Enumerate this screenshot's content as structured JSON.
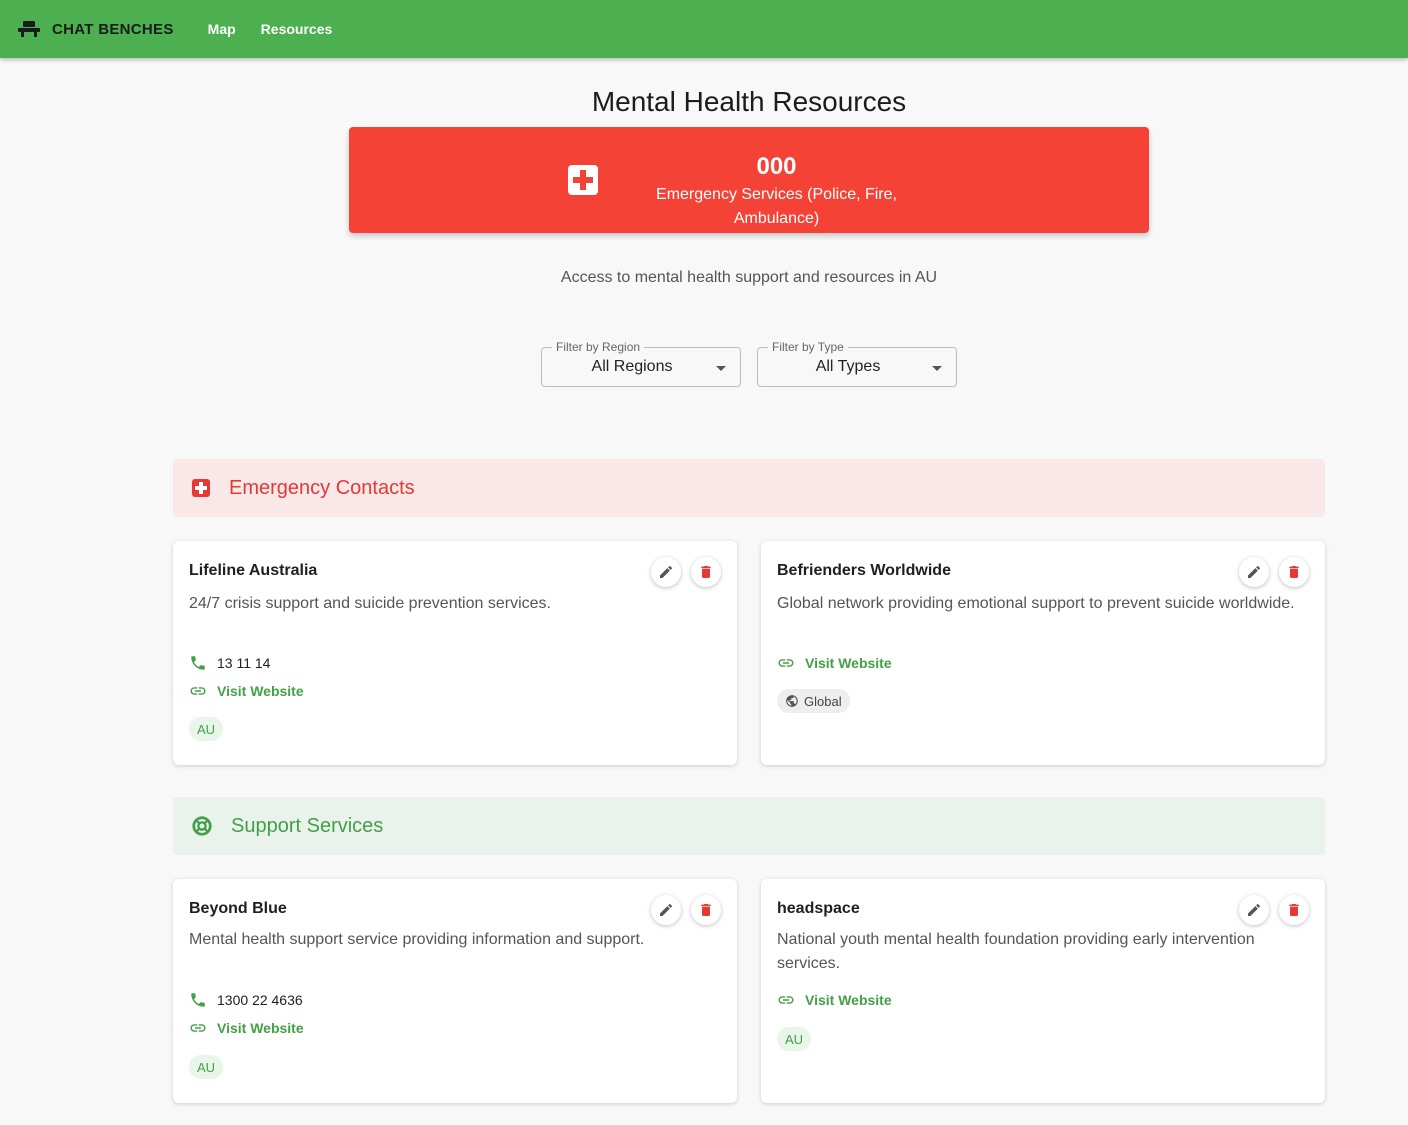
{
  "app": {
    "brand": "CHAT BENCHES"
  },
  "nav": {
    "map": "Map",
    "resources": "Resources"
  },
  "page": {
    "title": "Mental Health Resources",
    "subtitle": "Access to mental health support and resources in AU"
  },
  "emergency_banner": {
    "number": "000",
    "label": "Emergency Services (Police, Fire, Ambulance)",
    "color": "#f44336"
  },
  "filters": {
    "region": {
      "label": "Filter by Region",
      "value": "All Regions"
    },
    "type": {
      "label": "Filter by Type",
      "value": "All Types"
    }
  },
  "sections": {
    "emergency": {
      "title": "Emergency Contacts",
      "icon": "medical-cross-icon",
      "color": "#e53935"
    },
    "support": {
      "title": "Support Services",
      "icon": "lifebuoy-icon",
      "color": "#43a047"
    }
  },
  "cards": {
    "lifeline": {
      "name": "Lifeline Australia",
      "description": "24/7 crisis support and suicide prevention services.",
      "phone": "13 11 14",
      "website_label": "Visit Website",
      "region": "AU"
    },
    "befrienders": {
      "name": "Befrienders Worldwide",
      "description": "Global network providing emotional support to prevent suicide worldwide.",
      "website_label": "Visit Website",
      "region": "Global"
    },
    "beyondblue": {
      "name": "Beyond Blue",
      "description": "Mental health support service providing information and support.",
      "phone": "1300 22 4636",
      "website_label": "Visit Website",
      "region": "AU"
    },
    "headspace": {
      "name": "headspace",
      "description": "National youth mental health foundation providing early intervention services.",
      "website_label": "Visit Website",
      "region": "AU"
    }
  },
  "colors": {
    "primary": "#4caf50",
    "accent_green": "#43a047",
    "danger": "#e53935"
  }
}
